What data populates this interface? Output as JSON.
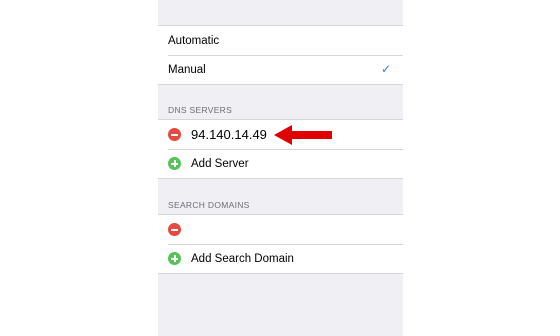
{
  "config_mode": {
    "options": [
      {
        "label": "Automatic",
        "selected": false
      },
      {
        "label": "Manual",
        "selected": true
      }
    ]
  },
  "dns_servers": {
    "header": "DNS SERVERS",
    "entries": [
      {
        "value": "94.140.14.49"
      }
    ],
    "add_label": "Add Server"
  },
  "search_domains": {
    "header": "SEARCH DOMAINS",
    "entries": [
      {
        "value": ""
      }
    ],
    "add_label": "Add Search Domain"
  },
  "colors": {
    "accent": "#2f7cf6",
    "delete": "#e5493f",
    "add": "#57c25a",
    "annotation_arrow": "#e00000"
  },
  "icons": {
    "checkmark": "checkmark-icon",
    "delete": "minus-circle-icon",
    "add": "plus-circle-icon",
    "annotation": "red-arrow-icon"
  }
}
